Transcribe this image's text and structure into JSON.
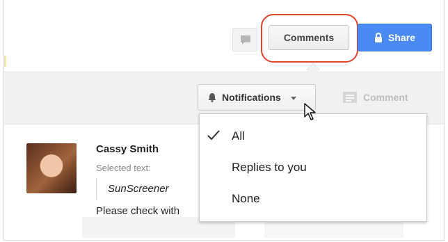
{
  "header": {
    "comments_label": "Comments",
    "share_label": "Share"
  },
  "toolbar": {
    "notifications_label": "Notifications",
    "comment_label": "Comment"
  },
  "comment": {
    "author": "Cassy Smith",
    "selected_label": "Selected text:",
    "quote": "SunScreener",
    "message": "Please check with"
  },
  "dropdown": {
    "items": [
      {
        "label": "All",
        "checked": true
      },
      {
        "label": "Replies to you",
        "checked": false
      },
      {
        "label": "None",
        "checked": false
      }
    ]
  },
  "colors": {
    "share_blue": "#4a8af4",
    "highlight_red": "#e0442c"
  }
}
